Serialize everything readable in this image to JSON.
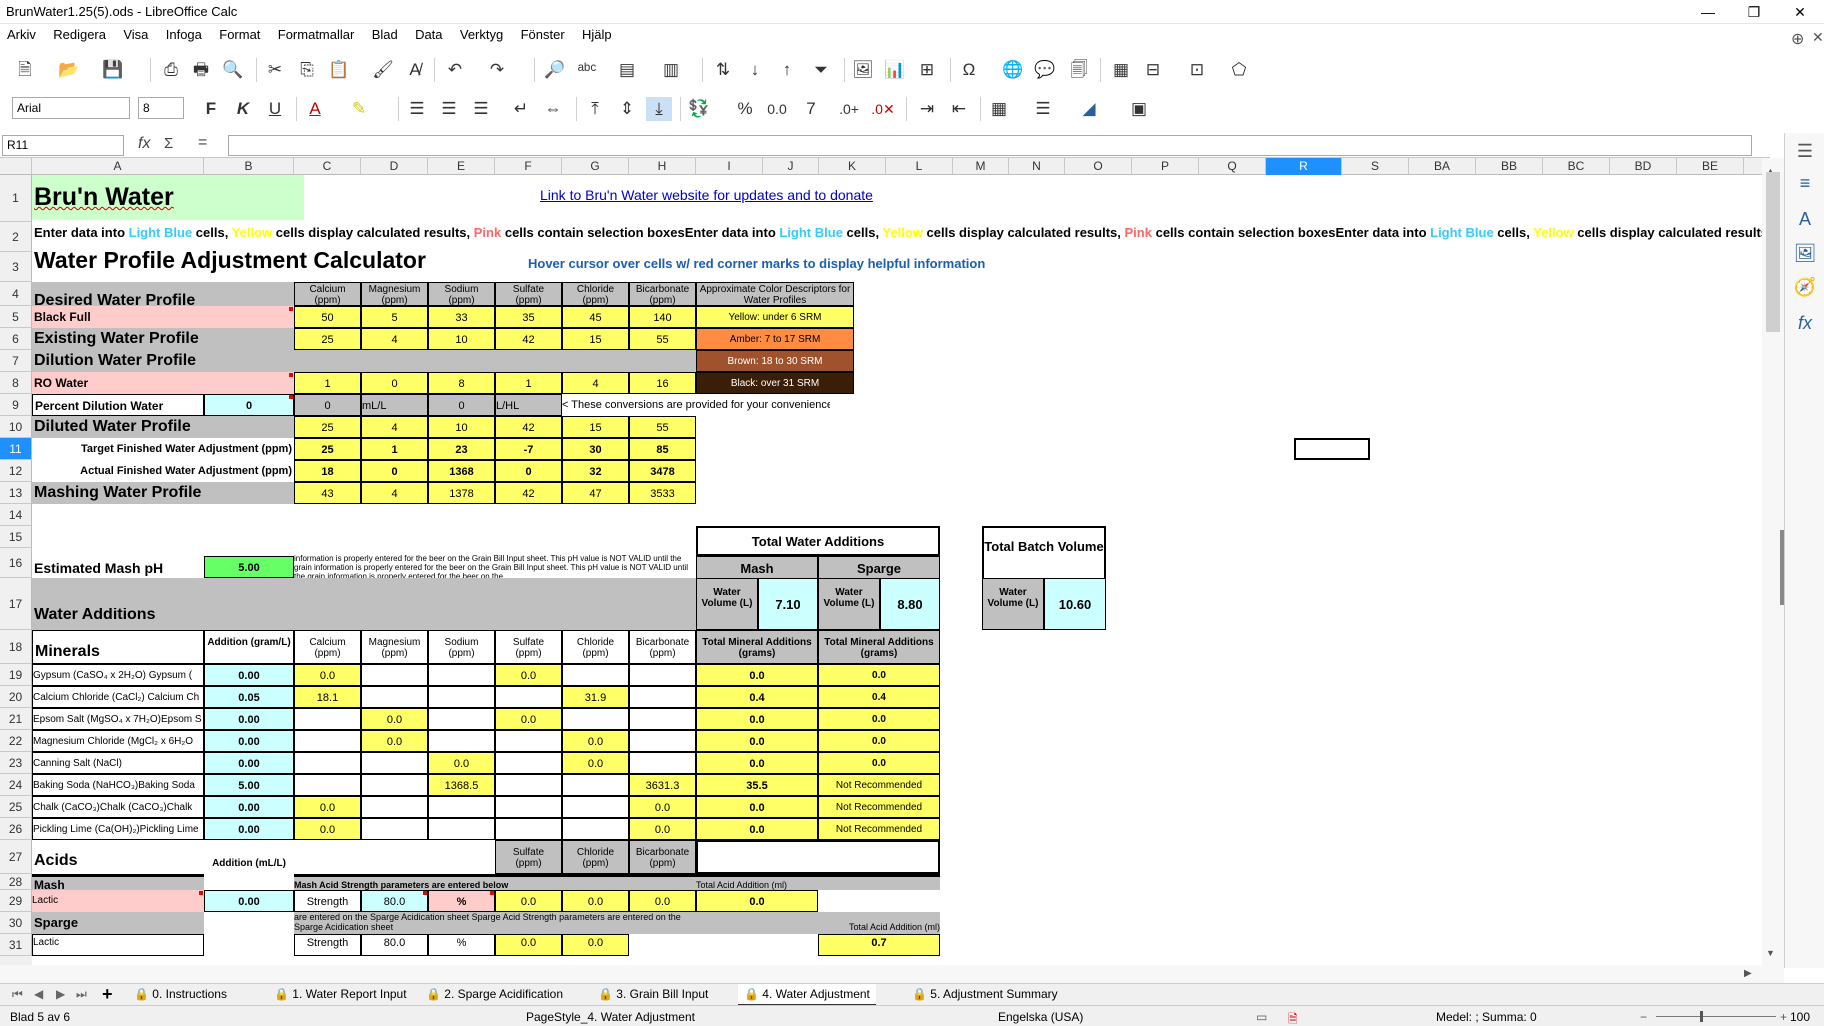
{
  "window": {
    "title": "BrunWater1.25(5).ods - LibreOffice Calc",
    "minimize": "—",
    "restore": "❐",
    "close": "✕"
  },
  "menu": [
    "Arkiv",
    "Redigera",
    "Visa",
    "Infoga",
    "Format",
    "Formatmallar",
    "Blad",
    "Data",
    "Verktyg",
    "Fönster",
    "Hjälp"
  ],
  "format_bar": {
    "font_name": "Arial",
    "font_size": "8"
  },
  "formula_bar": {
    "cell_ref": "R11",
    "fx": "fx",
    "sum": "Σ",
    "equals": "=",
    "content": ""
  },
  "columns": [
    "A",
    "B",
    "C",
    "D",
    "E",
    "F",
    "G",
    "H",
    "I",
    "J",
    "K",
    "L",
    "M",
    "N",
    "O",
    "P",
    "Q",
    "R",
    "S",
    "BA",
    "BB",
    "BC",
    "BD",
    "BE"
  ],
  "rows": [
    "1",
    "2",
    "3",
    "4",
    "5",
    "6",
    "7",
    "8",
    "9",
    "10",
    "11",
    "12",
    "13",
    "14",
    "15",
    "16",
    "17",
    "18",
    "19",
    "20",
    "21",
    "22",
    "23",
    "24",
    "25",
    "26",
    "27",
    "28",
    "29",
    "30",
    "31"
  ],
  "sheet": {
    "title": "Bru'n Water",
    "link": "Link to Bru'n Water website for updates and to donate",
    "row2": {
      "p1": "Enter data into ",
      "lightblue": "Light Blue",
      "p2": " cells, ",
      "yellow": "Yellow",
      "p3": " cells display calculated results, ",
      "pink": "Pink",
      "p4": " cells contain selection boxes"
    },
    "calc_title": "Water Profile Adjustment Calculator",
    "hover_note": "Hover cursor over cells w/ red corner marks to display helpful information",
    "ion_headers": [
      [
        "Calcium",
        "(ppm)"
      ],
      [
        "Magnesium",
        "(ppm)"
      ],
      [
        "Sodium",
        "(ppm)"
      ],
      [
        "Sulfate",
        "(ppm)"
      ],
      [
        "Chloride",
        "(ppm)"
      ],
      [
        "Bicarbonate",
        "(ppm)"
      ]
    ],
    "color_desc_header": "Approximate Color Descriptors for Water Profiles",
    "color_desc": [
      "Yellow: under 6 SRM",
      "Amber: 7 to 17 SRM",
      "Brown: 18 to 30 SRM",
      "Black: over 31 SRM"
    ],
    "desired_label": "Desired Water Profile",
    "desired_name": "Black Full",
    "desired_vals": [
      "50",
      "5",
      "33",
      "35",
      "45",
      "140"
    ],
    "existing_label": "Existing Water Profile",
    "existing_vals": [
      "25",
      "4",
      "10",
      "42",
      "15",
      "55"
    ],
    "dilution_label": "Dilution Water Profile",
    "ro_name": "RO Water",
    "ro_vals": [
      "1",
      "0",
      "8",
      "1",
      "4",
      "16"
    ],
    "percent_dilution_label": "Percent Dilution Water",
    "percent_dilution_val": "0",
    "conv": {
      "c": "0",
      "d": "mL/L",
      "e": "0",
      "f": "L/HL",
      "note": "< These conversions are provided for your convenience"
    },
    "diluted_label": "Diluted Water Profile",
    "diluted_vals": [
      "25",
      "4",
      "10",
      "42",
      "15",
      "55"
    ],
    "target_label": "Target Finished Water Adjustment (ppm)",
    "target_vals": [
      "25",
      "1",
      "23",
      "-7",
      "30",
      "85"
    ],
    "actual_label": "Actual Finished Water Adjustment (ppm)",
    "actual_vals": [
      "18",
      "0",
      "1368",
      "0",
      "32",
      "3478"
    ],
    "mashing_label": "Mashing Water Profile",
    "mashing_vals": [
      "43",
      "4",
      "1378",
      "42",
      "47",
      "3533"
    ],
    "twa_label": "Total Water Additions",
    "mash_label": "Mash",
    "sparge_label": "Sparge",
    "tbv_label": "Total Batch Volume",
    "water_volume_label": "Water Volume (L)",
    "mash_volume": "7.10",
    "sparge_volume": "8.80",
    "total_volume": "10.60",
    "mash_ph_label": "Estimated Mash pH",
    "mash_ph_val": "5.00",
    "ph_note": "information is properly entered for the beer on the Grain Bill Input sheet.  This pH value is NOT VALID until the grain information is properly entered for the beer on the Grain Bill Input sheet.  This pH value is NOT VALID until the grain information is properly entered for the beer on the",
    "water_additions_label": "Water Additions",
    "minerals_label": "Minerals",
    "addition_header": "Addition (gram/L)",
    "tma_header": "Total Mineral Additions (grams)",
    "minerals": [
      {
        "name": "Gypsum (CaSO₄ x 2H₂O) Gypsum (",
        "add": "0.00",
        "c": "0.0",
        "d": "",
        "e": "",
        "f": "0.0",
        "g": "",
        "h": "",
        "mash": "0.0",
        "sparge": "0.0"
      },
      {
        "name": "Calcium Chloride (CaCl₂) Calcium Ch",
        "add": "0.05",
        "c": "18.1",
        "d": "",
        "e": "",
        "f": "",
        "g": "31.9",
        "h": "",
        "mash": "0.4",
        "sparge": "0.4"
      },
      {
        "name": "Epsom Salt (MgSO₄ x 7H₂O)Epsom S",
        "add": "0.00",
        "c": "",
        "d": "0.0",
        "e": "",
        "f": "0.0",
        "g": "",
        "h": "",
        "mash": "0.0",
        "sparge": "0.0"
      },
      {
        "name": "Magnesium Chloride (MgCl₂ x 6H₂O",
        "add": "0.00",
        "c": "",
        "d": "0.0",
        "e": "",
        "f": "",
        "g": "0.0",
        "h": "",
        "mash": "0.0",
        "sparge": "0.0"
      },
      {
        "name": "Canning Salt (NaCl)",
        "add": "0.00",
        "c": "",
        "d": "",
        "e": "0.0",
        "f": "",
        "g": "0.0",
        "h": "",
        "mash": "0.0",
        "sparge": "0.0"
      },
      {
        "name": "Baking Soda (NaHCO₃)Baking Soda",
        "add": "5.00",
        "c": "",
        "d": "",
        "e": "1368.5",
        "f": "",
        "g": "",
        "h": "3631.3",
        "mash": "35.5",
        "sparge": "Not Recommended"
      },
      {
        "name": "Chalk (CaCO₃)Chalk (CaCO₃)Chalk",
        "add": "0.00",
        "c": "0.0",
        "d": "",
        "e": "",
        "f": "",
        "g": "",
        "h": "0.0",
        "mash": "0.0",
        "sparge": "Not Recommended"
      },
      {
        "name": "Pickling Lime (Ca(OH)₂)Pickling Lime",
        "add": "0.00",
        "c": "0.0",
        "d": "",
        "e": "",
        "f": "",
        "g": "",
        "h": "0.0",
        "mash": "0.0",
        "sparge": "Not Recommended"
      }
    ],
    "acids_label": "Acids",
    "acid_addition_header": "Addition (mL/L)",
    "acid_ion_headers": [
      [
        "Sulfate",
        "(ppm)"
      ],
      [
        "Chloride",
        "(ppm)"
      ],
      [
        "Bicarbonate",
        "(ppm)"
      ]
    ],
    "mash_row_label": "Mash",
    "mash_acid_note": "Mash Acid Strength parameters are entered below",
    "total_acid_label": "Total Acid Addition (ml)",
    "lactic1": {
      "name": "Lactic",
      "add": "0.00",
      "strength_label": "Strength",
      "strength": "80.0",
      "unit": "%",
      "f": "0.0",
      "g": "0.0",
      "h": "0.0",
      "total": "0.0"
    },
    "sparge_row_label": "Sparge",
    "sparge_acid_note": "are entered on the Sparge Acidication sheet  Sparge Acid Strength parameters are entered on the Sparge Acidication sheet",
    "total_acid_label2": "Total Acid Addition (ml)",
    "lactic2": {
      "name": "Lactic",
      "strength_label": "Strength",
      "strength": "80.0",
      "unit": "%",
      "f": "0.0",
      "g": "0.0",
      "total": "0.7"
    }
  },
  "tabs": [
    "0. Instructions",
    "1. Water Report Input",
    "2. Sparge Acidification",
    "3. Grain Bill Input",
    "4. Water Adjustment",
    "5. Adjustment Summary"
  ],
  "status": {
    "sheet": "Blad 5 av 6",
    "pagestyle": "PageStyle_4. Water Adjustment",
    "language": "Engelska (USA)",
    "summary": "Medel: ; Summa: 0",
    "zoom": "100 %"
  },
  "colors": {
    "light_blue_text": "#33ccff",
    "yellow_text": "#ffff00",
    "pink_text": "#ff6666",
    "selected_col": "#1e90ff"
  }
}
